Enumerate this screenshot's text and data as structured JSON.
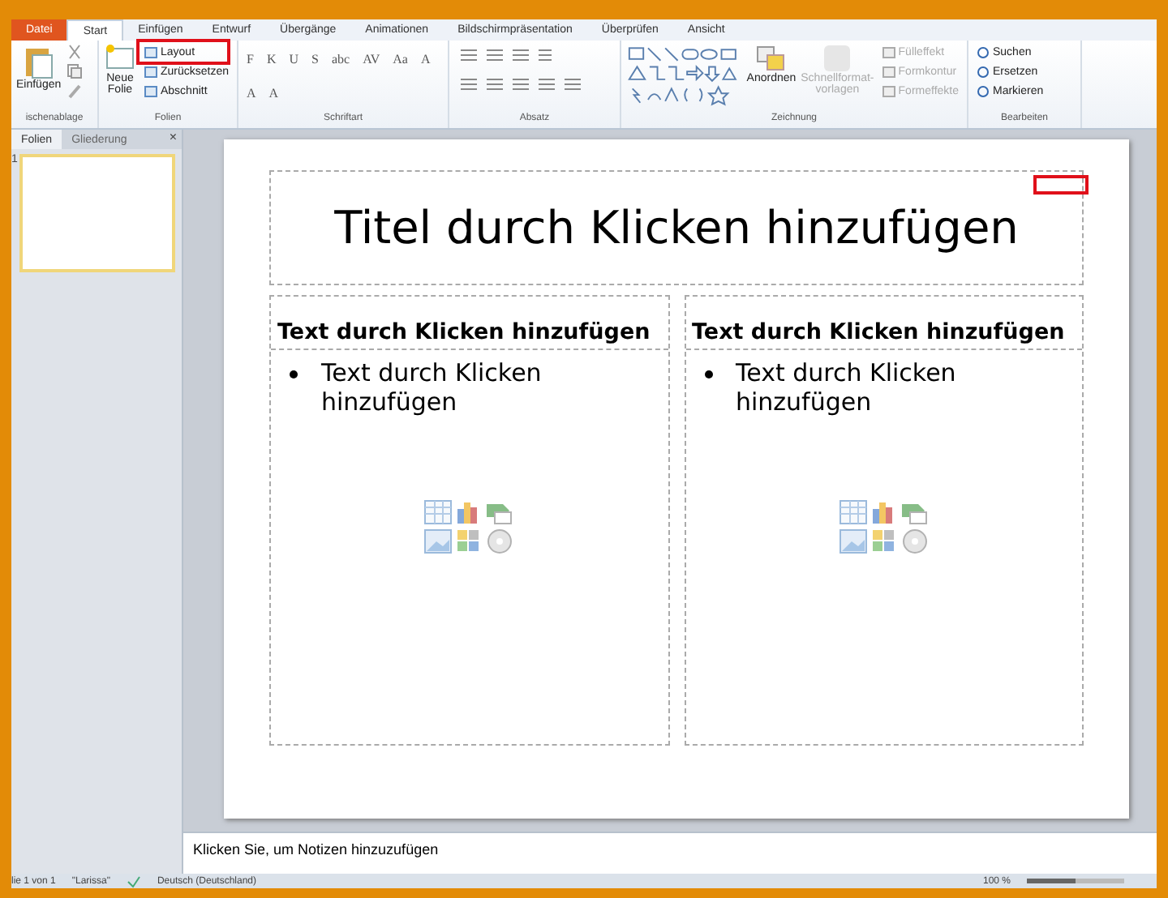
{
  "tabs": [
    {
      "label": "Datei",
      "kind": "file",
      "selected": false
    },
    {
      "label": "Start",
      "kind": "tab",
      "selected": true
    },
    {
      "label": "Einfügen",
      "kind": "tab",
      "selected": false
    },
    {
      "label": "Entwurf",
      "kind": "tab",
      "selected": false
    },
    {
      "label": "Übergänge",
      "kind": "tab",
      "selected": false
    },
    {
      "label": "Animationen",
      "kind": "tab",
      "selected": false
    },
    {
      "label": "Bildschirmpräsentation",
      "kind": "tab",
      "selected": false
    },
    {
      "label": "Überprüfen",
      "kind": "tab",
      "selected": false
    },
    {
      "label": "Ansicht",
      "kind": "tab",
      "selected": false
    }
  ],
  "ribbon": {
    "clipboard": {
      "label": "ischenablage",
      "paste": "Einfügen"
    },
    "slides": {
      "label": "Folien",
      "new_slide": [
        "Neue",
        "Folie"
      ],
      "items": [
        {
          "label": "Layout",
          "highlighted": true
        },
        {
          "label": "Zurücksetzen",
          "highlighted": false
        },
        {
          "label": "Abschnitt",
          "highlighted": false
        }
      ]
    },
    "font": {
      "label": "Schriftart",
      "buttons": [
        "F",
        "K",
        "U",
        "S",
        "abc",
        "AV",
        "Aa",
        "A",
        "A",
        "A"
      ]
    },
    "paragraph": {
      "label": "Absatz"
    },
    "drawing": {
      "label": "Zeichnung",
      "arrange": "Anordnen",
      "quick_styles": {
        "label": "Schnellformat-vorlagen",
        "disabled": true
      },
      "items": [
        {
          "label": "Fülleffekt",
          "disabled": true
        },
        {
          "label": "Formkontur",
          "disabled": true
        },
        {
          "label": "Formeffekte",
          "disabled": true
        }
      ]
    },
    "editing": {
      "label": "Bearbeiten",
      "items": [
        "Suchen",
        "Ersetzen",
        "Markieren"
      ]
    }
  },
  "panel": {
    "tabs": [
      {
        "label": "Folien",
        "selected": true
      },
      {
        "label": "Gliederung",
        "selected": false
      }
    ],
    "close": "×",
    "slide_number": "1"
  },
  "slide": {
    "title": "Titel durch Klicken hinzufügen",
    "corner_marker": true,
    "columns": [
      {
        "heading": "Text durch Klicken hinzufügen",
        "bullet": "Text durch Klicken hinzufügen"
      },
      {
        "heading": "Text durch Klicken hinzufügen",
        "bullet": "Text durch Klicken hinzufügen"
      }
    ]
  },
  "notes": {
    "placeholder": "Klicken Sie, um Notizen hinzuzufügen"
  },
  "status_bar": {
    "slide": "lie 1 von 1",
    "theme": "\"Larissa\"",
    "language": "Deutsch (Deutschland)",
    "zoom": "100 %",
    "level": 0.5
  }
}
